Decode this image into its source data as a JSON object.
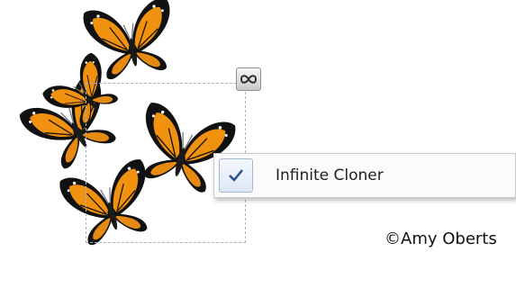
{
  "menu": {
    "items": [
      {
        "label": "Infinite Cloner",
        "checked": true,
        "icon": "check-icon"
      }
    ]
  },
  "handle": {
    "icon": "infinity-icon"
  },
  "credit": "©Amy Oberts",
  "butterflies": {
    "icon": "monarch-butterfly-icon",
    "count": 5
  }
}
